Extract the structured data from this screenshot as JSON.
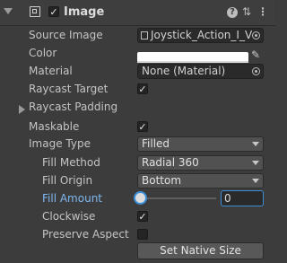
{
  "component": {
    "title": "Image",
    "enabled": true,
    "icons": [
      "help-icon",
      "preset-icon",
      "more-icon"
    ]
  },
  "fields": {
    "source_image": {
      "label": "Source Image",
      "value": "Joystick_Action_I_V"
    },
    "color": {
      "label": "Color",
      "value": "#ffffff"
    },
    "material": {
      "label": "Material",
      "value": "None (Material)"
    },
    "raycast_target": {
      "label": "Raycast Target",
      "checked": true
    },
    "raycast_padding": {
      "label": "Raycast Padding"
    },
    "maskable": {
      "label": "Maskable",
      "checked": true
    },
    "image_type": {
      "label": "Image Type",
      "value": "Filled"
    },
    "fill_method": {
      "label": "Fill Method",
      "value": "Radial 360"
    },
    "fill_origin": {
      "label": "Fill Origin",
      "value": "Bottom"
    },
    "fill_amount": {
      "label": "Fill Amount",
      "value": "0",
      "slider_fraction": 0
    },
    "clockwise": {
      "label": "Clockwise",
      "checked": true
    },
    "preserve_aspect": {
      "label": "Preserve Aspect",
      "checked": false
    }
  },
  "buttons": {
    "set_native_size": "Set Native Size"
  },
  "colors": {
    "accent": "#3b8fd9",
    "highlight_label": "#7fb7f0"
  }
}
